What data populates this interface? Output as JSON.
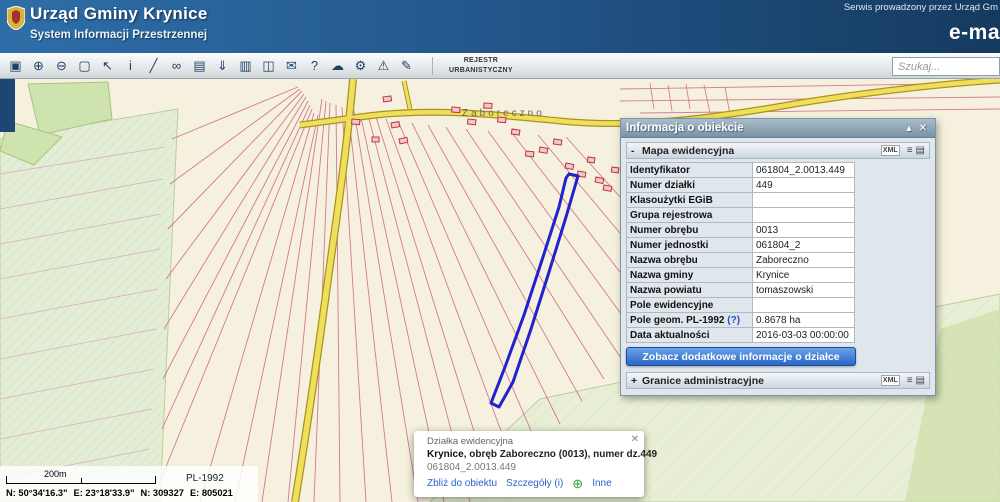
{
  "header": {
    "title": "Urząd Gminy Krynice",
    "subtitle": "System Informacji Przestrzennej",
    "service_note": "Serwis prowadzony przez Urząd Gm",
    "brand": "e-ma"
  },
  "toolbar": {
    "icons": [
      {
        "name": "zoom-window-icon",
        "glyph": "▣"
      },
      {
        "name": "zoom-in-icon",
        "glyph": "⊕"
      },
      {
        "name": "zoom-out-icon",
        "glyph": "⊖"
      },
      {
        "name": "select-area-icon",
        "glyph": "▢"
      },
      {
        "name": "pointer-icon",
        "glyph": "↖"
      },
      {
        "name": "info-icon",
        "glyph": "i"
      },
      {
        "name": "measure-icon",
        "glyph": "╱"
      },
      {
        "name": "link-icon",
        "glyph": "∞"
      },
      {
        "name": "print-icon",
        "glyph": "▤"
      },
      {
        "name": "download-icon",
        "glyph": "⇓"
      },
      {
        "name": "layers-icon",
        "glyph": "▥"
      },
      {
        "name": "compare-icon",
        "glyph": "◫"
      },
      {
        "name": "message-icon",
        "glyph": "✉"
      },
      {
        "name": "help-icon",
        "glyph": "?"
      },
      {
        "name": "cloud-icon",
        "glyph": "☁"
      },
      {
        "name": "settings-icon",
        "glyph": "⚙"
      },
      {
        "name": "alerts-icon",
        "glyph": "⚠"
      },
      {
        "name": "draw-icon",
        "glyph": "✎"
      }
    ],
    "rejestr_line1": "REJESTR",
    "rejestr_line2": "URBANISTYCZNY",
    "search_placeholder": "Szukaj..."
  },
  "map": {
    "place_label": "Zaboreczno",
    "highlight_color": "#2222cc"
  },
  "info_panel": {
    "title": "Informacja o obiekcie",
    "section1": {
      "state": "-",
      "label": "Mapa ewidencyjna",
      "xml": "XML"
    },
    "rows": [
      {
        "label": "Identyfikator",
        "value": "061804_2.0013.449"
      },
      {
        "label": "Numer działki",
        "value": "449"
      },
      {
        "label": "Klasoużytki EGiB",
        "value": ""
      },
      {
        "label": "Grupa rejestrowa",
        "value": ""
      },
      {
        "label": "Numer obrębu",
        "value": "0013"
      },
      {
        "label": "Numer jednostki",
        "value": "061804_2"
      },
      {
        "label": "Nazwa obrębu",
        "value": "Zaboreczno"
      },
      {
        "label": "Nazwa gminy",
        "value": "Krynice"
      },
      {
        "label": "Nazwa powiatu",
        "value": "tomaszowski"
      },
      {
        "label": "Pole ewidencyjne",
        "value": ""
      },
      {
        "label": "Pole geom. PL-1992",
        "help": "(?)",
        "value": "0.8678 ha"
      },
      {
        "label": "Data aktualności",
        "value": "2016-03-03 00:00:00"
      }
    ],
    "button_label": "Zobacz dodatkowe informacje o działce",
    "section2": {
      "state": "+",
      "label": "Granice administracyjne",
      "xml": "XML"
    },
    "accent_color": "#2a66c8"
  },
  "feature_popup": {
    "title": "Działka ewidencyjna",
    "name": "Krynice",
    "name_rest": ", obręb Zaboreczno (0013), numer dz.449",
    "object_id": "061804_2.0013.449",
    "link_zoom": "Zbliż do obiektu",
    "link_details": "Szczegóły (i)",
    "link_other": "Inne"
  },
  "status_bar": {
    "scale_label": "200m",
    "crs_label": "PL-1992",
    "coords": [
      "N: 50°34'16.3\"",
      "E: 23°18'33.9\"",
      "N: 309327",
      "E: 805021"
    ]
  },
  "glyphs": {
    "close": "✕",
    "collapse": "▴",
    "list": "≡",
    "print": "▤",
    "plus": "⊕"
  }
}
